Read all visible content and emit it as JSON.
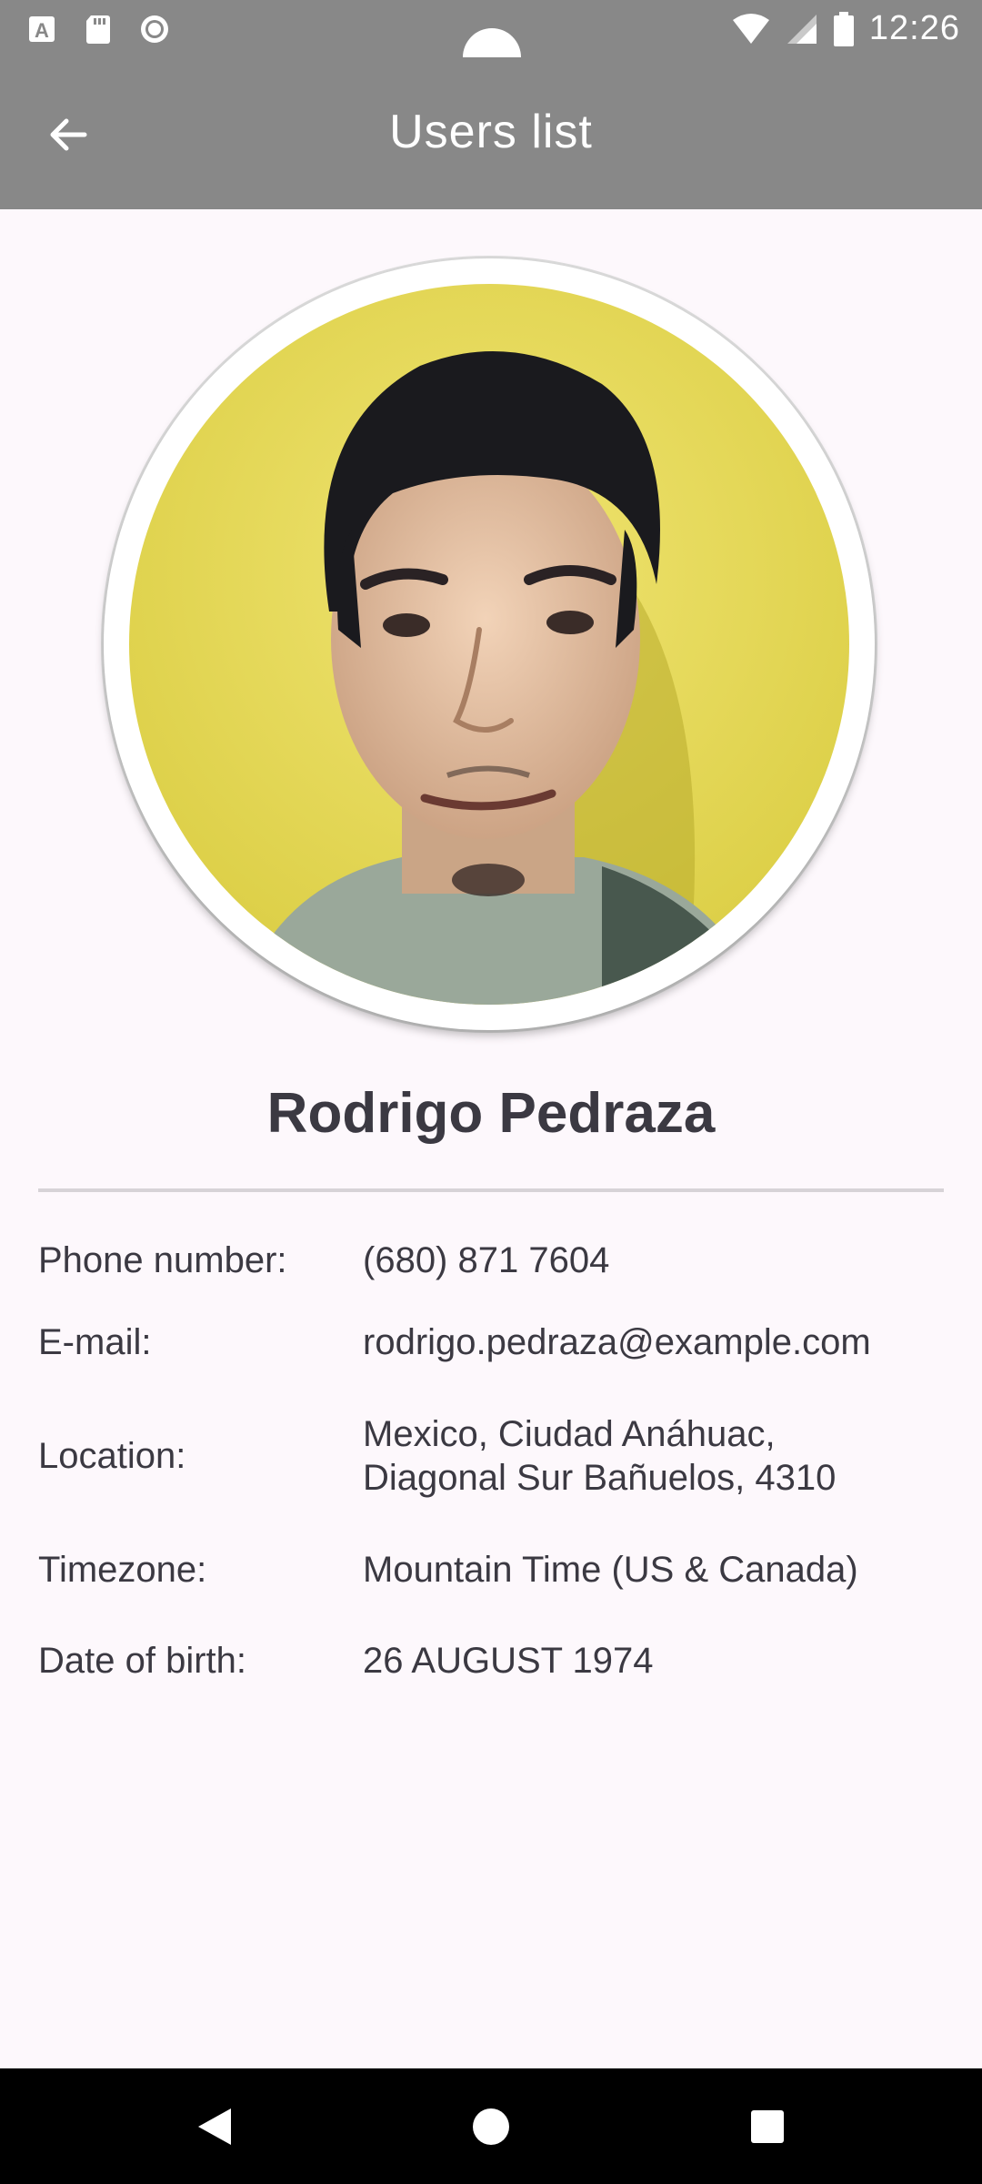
{
  "status_bar": {
    "time": "12:26",
    "icons_left": [
      "keyboard-a-icon",
      "sd-card-icon",
      "record-icon"
    ],
    "icons_right": [
      "wifi-icon",
      "cell-signal-icon",
      "battery-icon"
    ]
  },
  "app_bar": {
    "title": "Users list",
    "back_icon": "arrow-left-icon"
  },
  "profile": {
    "name": "Rodrigo Pedraza",
    "fields": {
      "phone_label": "Phone number:",
      "phone_value": "(680) 871 7604",
      "email_label": "E-mail:",
      "email_value": "rodrigo.pedraza@example.com",
      "location_label": "Location:",
      "location_value_line1": "Mexico, Ciudad Anáhuac,",
      "location_value_line2": "Diagonal Sur Bañuelos, 4310",
      "timezone_label": "Timezone:",
      "timezone_value": "Mountain Time (US & Canada)",
      "dob_label": "Date of birth:",
      "dob_value": "26 AUGUST 1974"
    }
  },
  "nav_bar": {
    "buttons": [
      "back-triangle-icon",
      "home-circle-icon",
      "recents-square-icon"
    ]
  },
  "colors": {
    "bar_gray": "#888888",
    "background": "#fdf8fc",
    "text": "#3b3942",
    "avatar_background": "#e8dc55"
  }
}
